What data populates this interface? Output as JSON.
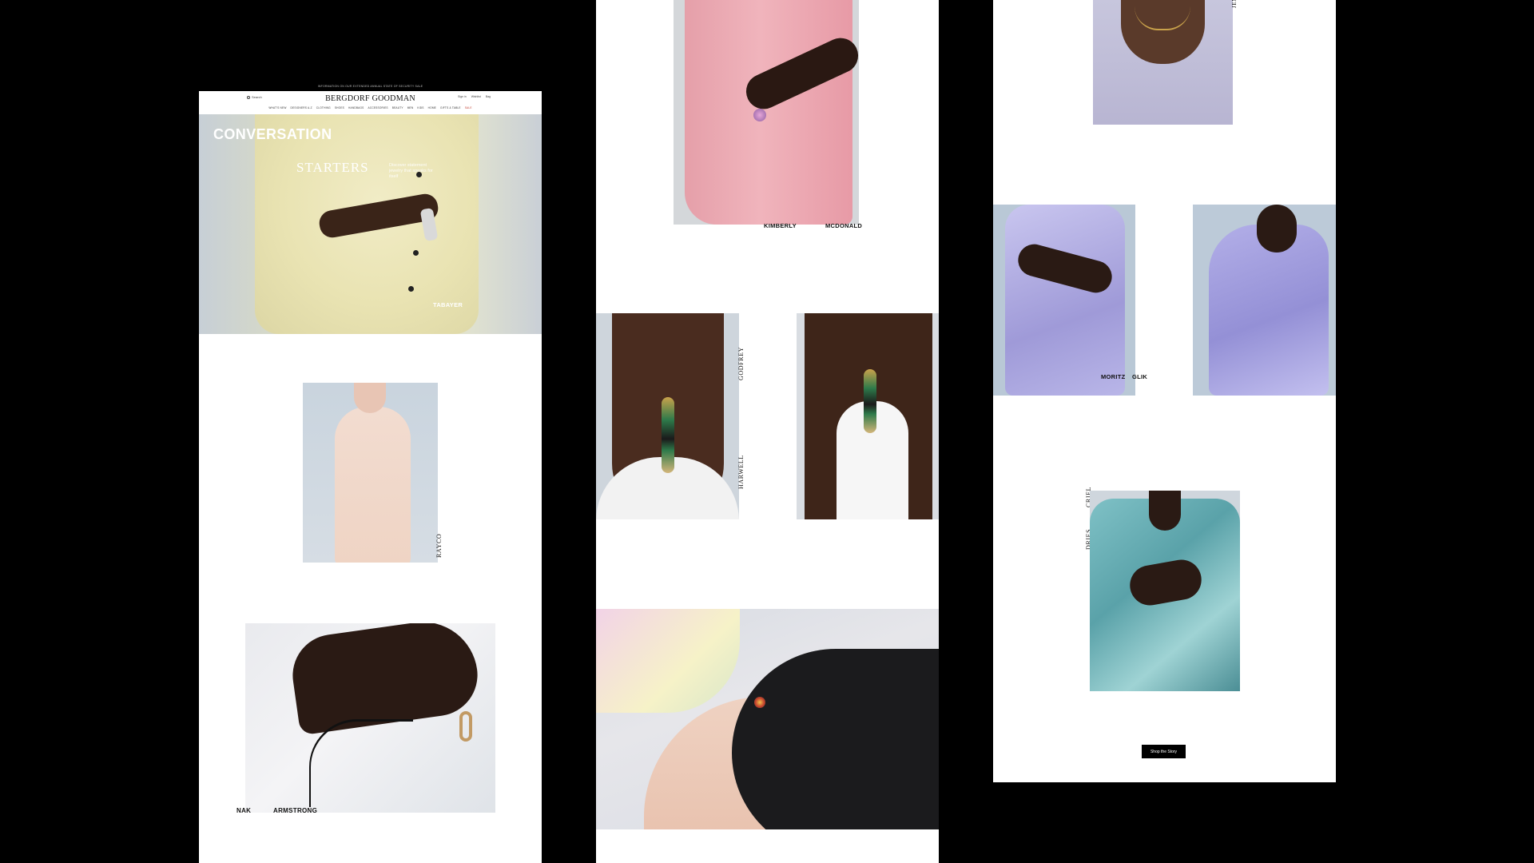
{
  "promo_text": "INFORMATION ON OUR EXTENDED ANNUAL STATE OF SECURITY SALE",
  "header": {
    "search_label": "Search",
    "logo": "BERGDORF GOODMAN",
    "account": [
      "Sign in",
      "Wishlist",
      "Bag"
    ],
    "nav": [
      "WHAT'S NEW",
      "DESIGNERS A-Z",
      "CLOTHING",
      "SHOES",
      "HANDBAGS",
      "ACCESSORIES",
      "BEAUTY",
      "MEN",
      "KIDS",
      "HOME",
      "GIFTS & TABLE",
      "SALE"
    ]
  },
  "hero": {
    "title": "CONVERSATION",
    "subtitle": "STARTERS",
    "blurb": "Discover statement jewelry that speaks for itself",
    "designer": "TABAYER"
  },
  "labels": {
    "rayco": "RAYCO",
    "nak": "NAK",
    "armstrong": "ARMSTRONG",
    "kimberly": "KIMBERLY",
    "mcdonald": "MCDONALD",
    "godfrey": "GODFREY",
    "harwell": "HARWELL",
    "moritz": "MORITZ",
    "glik": "GLIK",
    "dries": "DRIES",
    "criel": "CRIEL",
    "jen": "JEN"
  },
  "cta": {
    "shop_label": "Shop the Story"
  },
  "colors": {
    "background": "#000000",
    "page": "#ffffff",
    "sale": "#c0392b"
  }
}
